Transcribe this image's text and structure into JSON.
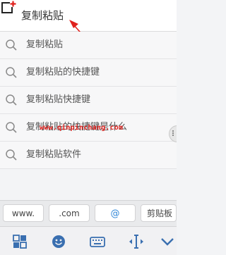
{
  "search": {
    "value": "复制粘贴"
  },
  "suggestions": [
    "复制粘贴",
    "复制粘贴的快捷键",
    "复制粘贴快捷键",
    "复制粘贴的快捷键是什么",
    "复制粘贴软件"
  ],
  "watermark": "www.qinpinchang.com",
  "quick_bar": {
    "www": "www.",
    "com": ".com",
    "at": "@",
    "clipboard": "剪贴板"
  },
  "toolbar_icons": [
    "grid-icon",
    "emoji-icon",
    "keyboard-icon",
    "cursor-move-icon",
    "keyboard-hide-icon"
  ],
  "colors": {
    "accent_red": "#e0201c",
    "at_blue": "#2f86d7",
    "toolbar_icon_blue": "#3a6fb0"
  }
}
